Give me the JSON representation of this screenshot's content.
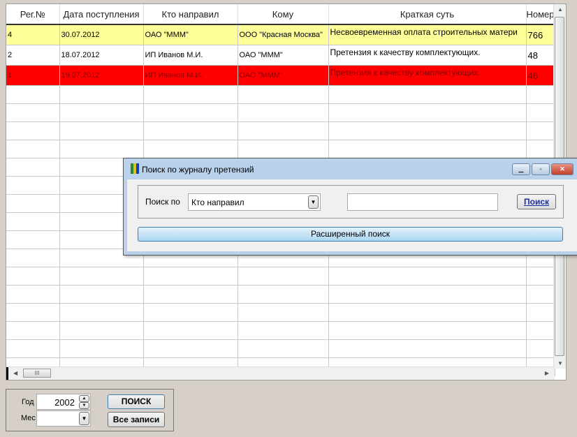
{
  "grid": {
    "columns": [
      "Рег.№",
      "Дата поступления",
      "Кто направил",
      "Кому",
      "Краткая суть",
      "Номер"
    ],
    "rows": [
      {
        "cells": [
          "4",
          "30.07.2012",
          "ОАО \"МММ\"",
          "ООО \"Красная Москва\"",
          "Несвоевременная оплата строительных матери",
          "766"
        ],
        "color": "#ffff99"
      },
      {
        "cells": [
          "2",
          "18.07.2012",
          "ИП Иванов М.И.",
          "ОАО \"МММ\"",
          "Претензия к качеству комплектующих.",
          "48"
        ],
        "color": "#ffffff"
      },
      {
        "cells": [
          "1",
          "19.07.2012",
          "ИП Иванов М.И.",
          "ОАО \"МММ\"",
          "Претензия к качеству комплектующих.",
          "46"
        ],
        "color": "#ff0000"
      }
    ],
    "hscroll_thumb": "III"
  },
  "dialog": {
    "title": "Поиск по журналу претензий",
    "search_by_label": "Поиск по",
    "search_by_value": "Кто направил",
    "search_value": "",
    "search_button": "Поиск",
    "advanced_button": "Расширенный поиск"
  },
  "filter": {
    "year_label": "Год",
    "year_value": "2002",
    "month_label": "Мес",
    "month_value": "",
    "search_button": "ПОИСК",
    "all_button": "Все записи"
  }
}
